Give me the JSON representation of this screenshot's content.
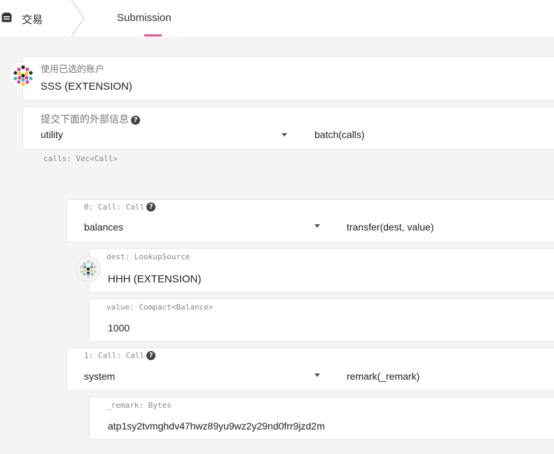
{
  "header": {
    "page_title": "交易",
    "tab_label": "Submission"
  },
  "account": {
    "label": "使用已选的账户",
    "value": "SSS (EXTENSION)"
  },
  "extrinsic": {
    "label": "提交下面的外部信息",
    "module": "utility",
    "method": "batch(calls)",
    "param_label": "calls: Vec<Call>"
  },
  "calls": [
    {
      "label": "0: Call: Call",
      "module": "balances",
      "method": "transfer(dest, value)",
      "params": {
        "dest_label": "dest: LookupSource",
        "dest_value": "HHH (EXTENSION)",
        "value_label": "value: Compact<Balance>",
        "value_value": "1000"
      }
    },
    {
      "label": "1: Call: Call",
      "module": "system",
      "method": "remark(_remark)",
      "params": {
        "remark_label": "_remark: Bytes",
        "remark_value": "atp1sy2tvmghdv47hwz89yu9wz2y29nd0frr9jzd2m"
      }
    }
  ],
  "colors": {
    "accent": "#e6589f",
    "background": "#f4f4f4"
  },
  "icons": {
    "page": "transfer-box-icon",
    "help": "question-circle-icon",
    "dropdown": "caret-down-icon"
  }
}
